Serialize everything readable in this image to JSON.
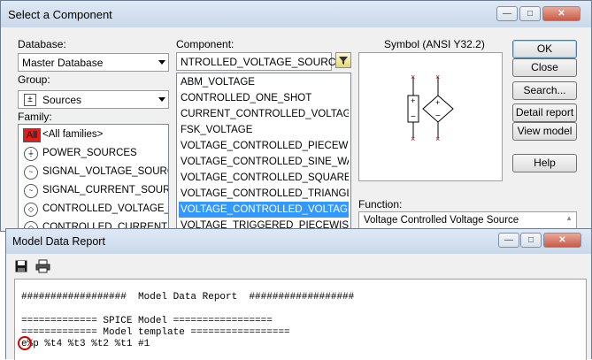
{
  "select_component": {
    "title": "Select a Component",
    "window_buttons": {
      "minimize": "—",
      "maximize": "□",
      "close": "✕"
    },
    "database_label": "Database:",
    "database_value": "Master Database",
    "group_label": "Group:",
    "group_value": "Sources",
    "family_label": "Family:",
    "families": [
      {
        "label": "<All families>",
        "icon": "all-families-icon",
        "icon_text": "All"
      },
      {
        "label": "POWER_SOURCES",
        "icon": "power-source-icon",
        "icon_text": "⏚"
      },
      {
        "label": "SIGNAL_VOLTAGE_SOURCES",
        "icon": "signal-voltage-icon",
        "icon_text": "~"
      },
      {
        "label": "SIGNAL_CURRENT_SOURCES",
        "icon": "signal-current-icon",
        "icon_text": "~"
      },
      {
        "label": "CONTROLLED_VOLTAGE_SOU",
        "icon": "controlled-voltage-icon",
        "icon_text": "◇"
      },
      {
        "label": "CONTROLLED_CURRENT_SOU",
        "icon": "controlled-current-icon",
        "icon_text": "◇"
      }
    ],
    "component_label": "Component:",
    "component_value": "NTROLLED_VOLTAGE_SOURCE",
    "components": [
      "ABM_VOLTAGE",
      "CONTROLLED_ONE_SHOT",
      "CURRENT_CONTROLLED_VOLTAGE_SOU",
      "FSK_VOLTAGE",
      "VOLTAGE_CONTROLLED_PIECEWISE_LI",
      "VOLTAGE_CONTROLLED_SINE_WAVE",
      "VOLTAGE_CONTROLLED_SQUARE_WAV",
      "VOLTAGE_CONTROLLED_TRIANGLE_WA",
      "VOLTAGE_CONTROLLED_VOLTAGE_SOU",
      "VOLTAGE_TRIGGERED_PIECEWISE_LINE"
    ],
    "selected_component_index": 8,
    "symbol_label": "Symbol (ANSI Y32.2)",
    "function_label": "Function:",
    "function_value": "Voltage Controlled Voltage Source",
    "buttons": {
      "ok": "OK",
      "close": "Close",
      "search": "Search...",
      "detail_report": "Detail report",
      "view_model": "View model",
      "help": "Help"
    }
  },
  "model_report": {
    "title": "Model Data Report",
    "window_buttons": {
      "minimize": "—",
      "maximize": "□",
      "close": "✕"
    },
    "lines": [
      "##################  Model Data Report  ##################",
      "",
      "============= SPICE Model =================",
      "============= Model template =================",
      "e%p %t4 %t3 %t2 %t1 #1"
    ]
  },
  "colors": {
    "selection": "#3399ff",
    "all_icon": "#e31b1b",
    "highlight_circle": "#d40000"
  }
}
